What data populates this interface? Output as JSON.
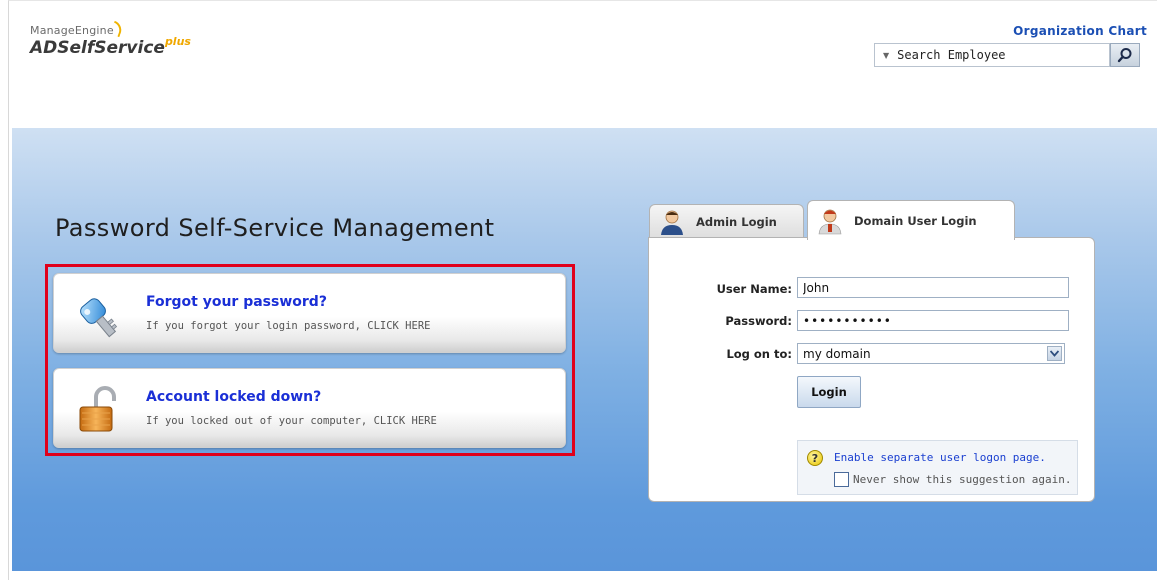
{
  "header": {
    "brand": "ManageEngine",
    "product": "ADSelfService",
    "product_suffix": "plus",
    "org_chart_link": "Organization Chart",
    "search_placeholder": "Search Employee"
  },
  "main": {
    "title": "Password Self-Service Management",
    "options": [
      {
        "title": "Forgot your password?",
        "description": "If you forgot your login password, CLICK HERE",
        "icon": "key-icon"
      },
      {
        "title": "Account locked down?",
        "description": "If you locked out of your computer, CLICK HERE",
        "icon": "padlock-icon"
      }
    ]
  },
  "login": {
    "tabs": [
      {
        "label": "Admin Login",
        "icon": "admin-user-icon",
        "active": false
      },
      {
        "label": "Domain User Login",
        "icon": "domain-user-icon",
        "active": true
      }
    ],
    "username_label": "User Name:",
    "username_value": "John",
    "password_label": "Password:",
    "password_value": "•••••••••••",
    "logon_label": "Log on to:",
    "logon_value": "my domain",
    "login_button": "Login",
    "suggestion_link": "Enable separate user logon page.",
    "suggestion_checkbox": "Never show this suggestion again."
  },
  "colors": {
    "accent_link": "#1a2fd6",
    "highlight_border": "#e0001b",
    "background_blue": "#5f9adc"
  }
}
